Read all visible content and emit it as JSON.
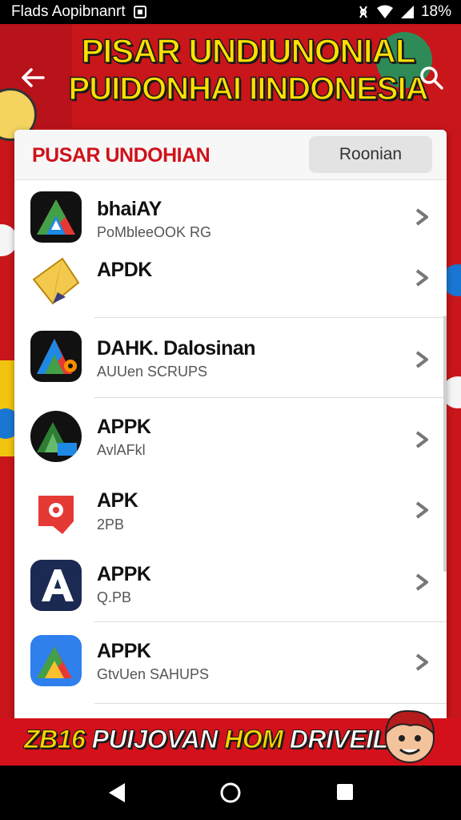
{
  "status_bar": {
    "app_name": "Flads Aopibnanrt",
    "battery": "18%"
  },
  "header": {
    "headline_line1": "PISAR UNDIUNONIAL",
    "headline_line2": "PUIDONHAI IINDONESIA"
  },
  "dialog": {
    "title": "PUSAR UNDOHIAN",
    "header_button": "Roonian",
    "items": [
      {
        "name": "bhaiAY",
        "sub": "PoMbleeOOK RG",
        "icon": "apk-triangle-icon"
      },
      {
        "name": "APDK",
        "sub": "",
        "icon": "paper-plane-icon"
      },
      {
        "name": "DAHK. Dalosinan",
        "sub": "AUUen SCRUPS",
        "icon": "apk-triangle-gear-icon"
      },
      {
        "name": "APPK",
        "sub": "AvlAFkl",
        "icon": "apk-green-triangle-icon"
      },
      {
        "name": "APK",
        "sub": "2PB",
        "icon": "red-pin-icon"
      },
      {
        "name": "APPK",
        "sub": "Q.PB",
        "icon": "letter-a-icon"
      },
      {
        "name": "APPK",
        "sub": "GtvUen SAHUPS",
        "icon": "apk-blue-triangle-icon"
      }
    ]
  },
  "promo": {
    "prefix": "ZB16",
    "part1": " PUIJOVAN ",
    "part2": "HOM",
    "part3": " DRIVEILS!"
  },
  "colors": {
    "brand_red": "#c8161b",
    "title_red": "#d0121b",
    "headline_yellow": "#ffe100"
  }
}
